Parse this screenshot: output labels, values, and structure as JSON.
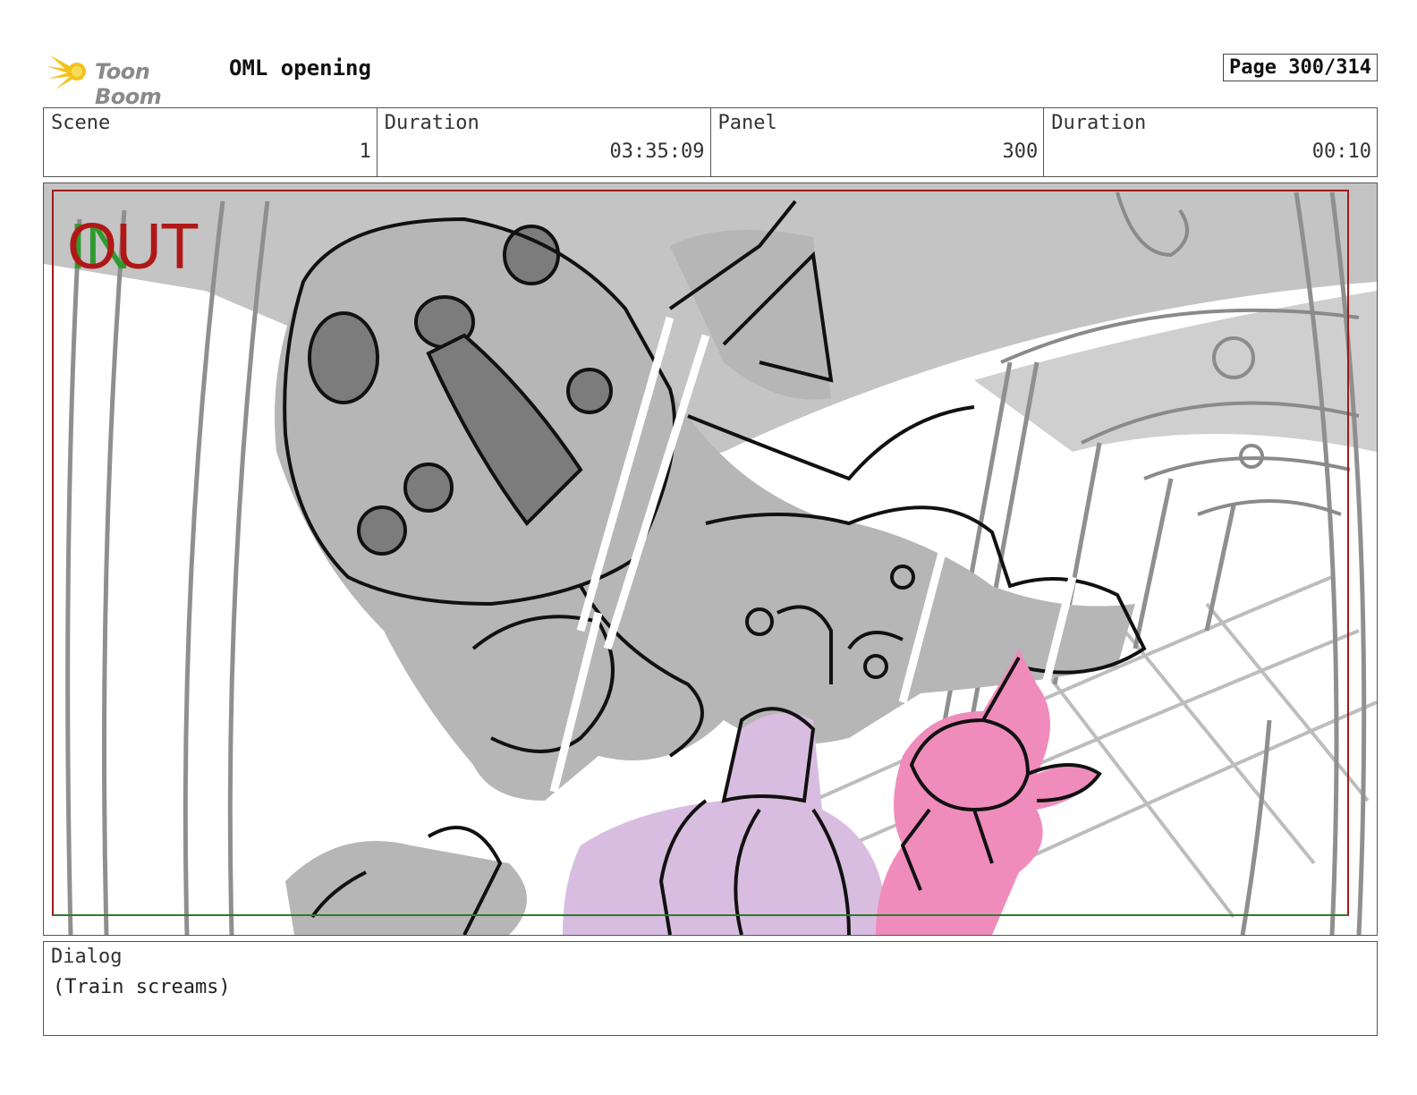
{
  "header": {
    "logo_text": "Toon Boom",
    "project_title": "OML opening",
    "page_label": "Page 300/314"
  },
  "info": {
    "scene_label": "Scene",
    "scene_value": "1",
    "scene_duration_label": "Duration",
    "scene_duration_value": "03:35:09",
    "panel_label": "Panel",
    "panel_value": "300",
    "panel_duration_label": "Duration",
    "panel_duration_value": "00:10"
  },
  "panel": {
    "in_marker": "IN",
    "out_marker": "OUT",
    "colors": {
      "robot_gray": "#b4b4b4",
      "sketch_line": "#1a1a1a",
      "purple_char": "#d8bde0",
      "pink_char": "#f08cbc",
      "safe_frame": "#a01a1a",
      "in_green": "#2f9a2f"
    }
  },
  "dialog": {
    "label": "Dialog",
    "text": "(Train screams)"
  }
}
